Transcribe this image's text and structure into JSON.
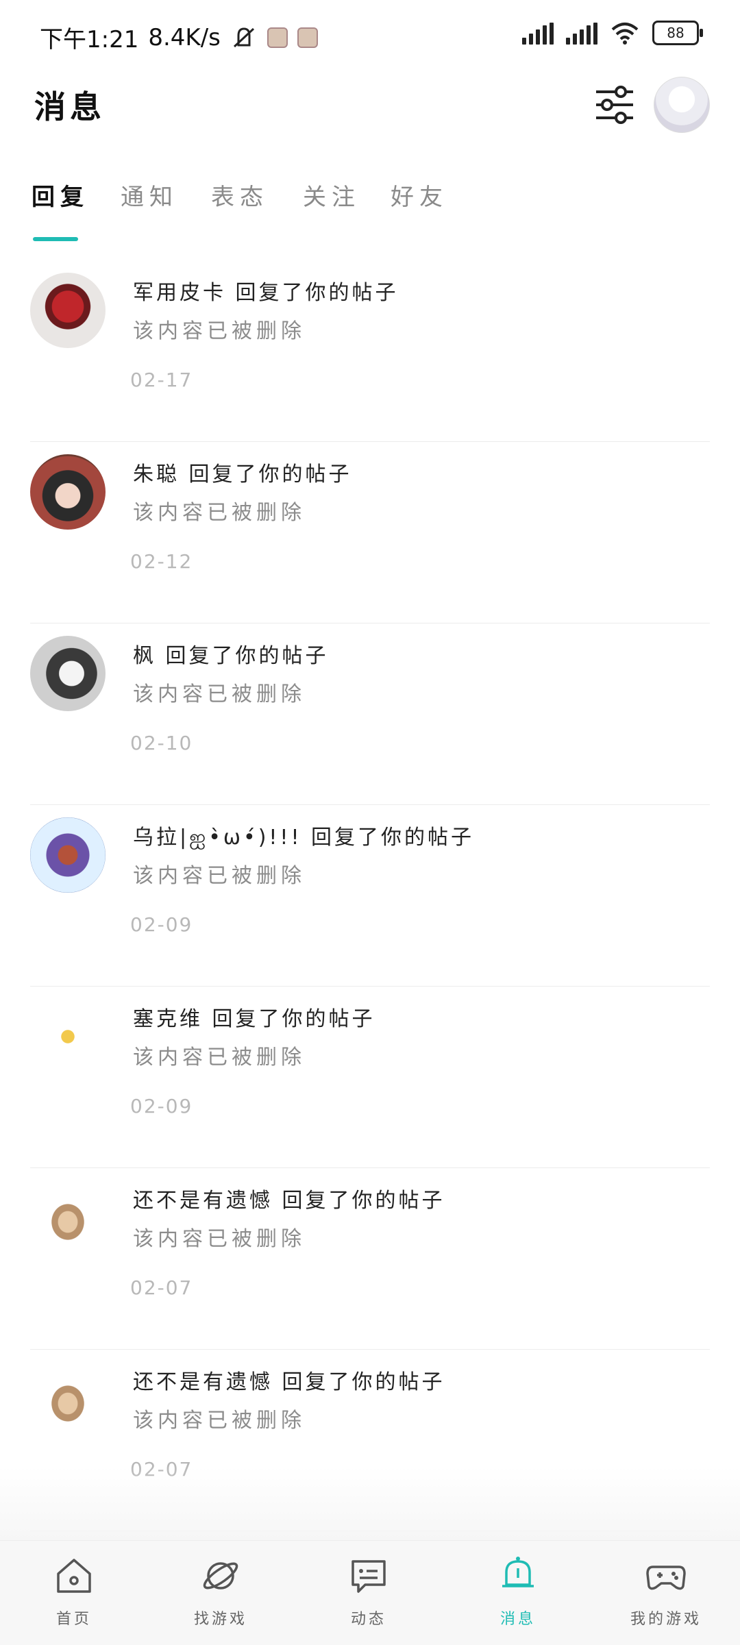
{
  "status": {
    "time": "下午1:21",
    "network_speed": "8.4K/s",
    "battery": "88"
  },
  "header": {
    "title": "消息"
  },
  "tabs": [
    {
      "label": "回复"
    },
    {
      "label": "通知"
    },
    {
      "label": "表态"
    },
    {
      "label": "关注"
    },
    {
      "label": "好友"
    }
  ],
  "messages": [
    {
      "user_action": "军用皮卡 回复了你的帖子",
      "content": "该内容已被删除",
      "date": "02-17"
    },
    {
      "user_action": "朱聪 回复了你的帖子",
      "content": "该内容已被删除",
      "date": "02-12"
    },
    {
      "user_action": "枫 回复了你的帖子",
      "content": "该内容已被删除",
      "date": "02-10"
    },
    {
      "user_action": "乌拉|ஐ•̀ω•́)!!! 回复了你的帖子",
      "content": "该内容已被删除",
      "date": "02-09"
    },
    {
      "user_action": "塞克维 回复了你的帖子",
      "content": "该内容已被删除",
      "date": "02-09"
    },
    {
      "user_action": "还不是有遗憾 回复了你的帖子",
      "content": "该内容已被删除",
      "date": "02-07"
    },
    {
      "user_action": "还不是有遗憾 回复了你的帖子",
      "content": "该内容已被删除",
      "date": "02-07"
    }
  ],
  "bottom_nav": [
    {
      "label": "首页",
      "icon": "home-icon"
    },
    {
      "label": "找游戏",
      "icon": "planet-icon"
    },
    {
      "label": "动态",
      "icon": "chat-icon"
    },
    {
      "label": "消息",
      "icon": "bell-icon"
    },
    {
      "label": "我的游戏",
      "icon": "gamepad-icon"
    }
  ],
  "colors": {
    "accent": "#1fbcb4"
  }
}
